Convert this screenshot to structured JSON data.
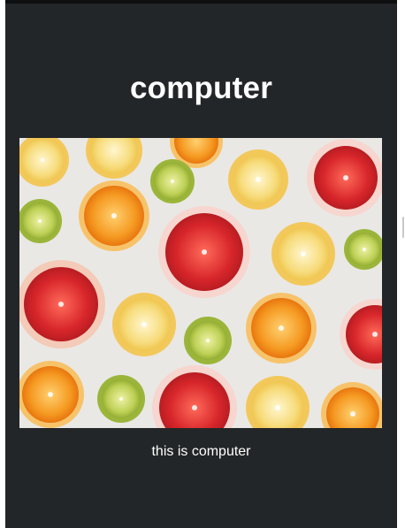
{
  "card": {
    "title": "computer",
    "caption": "this is computer",
    "image": {
      "subject": "citrus-slices-photo",
      "background_color": "#e9e8e5"
    }
  },
  "colors": {
    "card_background": "#232628",
    "top_bar": "#0d0f10",
    "text": "#ffffff",
    "grapefruit": "#d8262b",
    "orange": "#f28b1f",
    "lemon": "#f5d469",
    "lime": "#b9cc4d"
  }
}
